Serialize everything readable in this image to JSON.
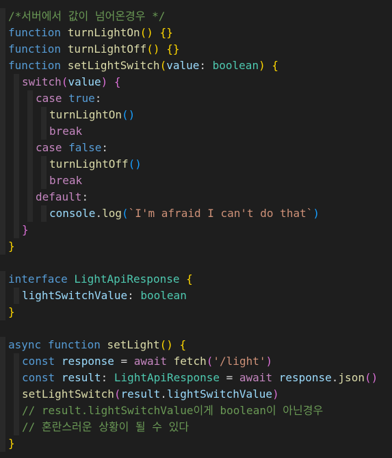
{
  "colors": {
    "background": "#1e1e1e",
    "comment": "#6a9955",
    "keyword": "#569cd6",
    "control": "#c586c0",
    "function": "#dcdcaa",
    "variable": "#9cdcfe",
    "type": "#4ec9b0",
    "string": "#ce9178",
    "plain": "#d4d4d4",
    "bracket_gold": "#ffd700",
    "bracket_pink": "#da70d6",
    "bracket_blue": "#179fff"
  },
  "code": {
    "lines": [
      {
        "indent": 0,
        "tokens": [
          {
            "t": "/*서버에서 값이 넘어온경우 */",
            "c": "comment"
          }
        ]
      },
      {
        "indent": 0,
        "tokens": [
          {
            "t": "function",
            "c": "keyword"
          },
          {
            "t": " ",
            "c": "plain"
          },
          {
            "t": "turnLightOn",
            "c": "function"
          },
          {
            "t": "()",
            "c": "bracket_gold"
          },
          {
            "t": " ",
            "c": "plain"
          },
          {
            "t": "{}",
            "c": "bracket_gold"
          }
        ]
      },
      {
        "indent": 0,
        "tokens": [
          {
            "t": "function",
            "c": "keyword"
          },
          {
            "t": " ",
            "c": "plain"
          },
          {
            "t": "turnLightOff",
            "c": "function"
          },
          {
            "t": "()",
            "c": "bracket_gold"
          },
          {
            "t": " ",
            "c": "plain"
          },
          {
            "t": "{}",
            "c": "bracket_gold"
          }
        ]
      },
      {
        "indent": 0,
        "tokens": [
          {
            "t": "function",
            "c": "keyword"
          },
          {
            "t": " ",
            "c": "plain"
          },
          {
            "t": "setLightSwitch",
            "c": "function"
          },
          {
            "t": "(",
            "c": "bracket_gold"
          },
          {
            "t": "value",
            "c": "variable"
          },
          {
            "t": ": ",
            "c": "plain"
          },
          {
            "t": "boolean",
            "c": "type"
          },
          {
            "t": ")",
            "c": "bracket_gold"
          },
          {
            "t": " ",
            "c": "plain"
          },
          {
            "t": "{",
            "c": "bracket_gold"
          }
        ]
      },
      {
        "indent": 1,
        "tokens": [
          {
            "t": "switch",
            "c": "control"
          },
          {
            "t": "(",
            "c": "bracket_pink"
          },
          {
            "t": "value",
            "c": "variable"
          },
          {
            "t": ")",
            "c": "bracket_pink"
          },
          {
            "t": " ",
            "c": "plain"
          },
          {
            "t": "{",
            "c": "bracket_pink"
          }
        ]
      },
      {
        "indent": 2,
        "tokens": [
          {
            "t": "case",
            "c": "control"
          },
          {
            "t": " ",
            "c": "plain"
          },
          {
            "t": "true",
            "c": "keyword"
          },
          {
            "t": ":",
            "c": "plain"
          }
        ]
      },
      {
        "indent": 3,
        "tokens": [
          {
            "t": "turnLightOn",
            "c": "function"
          },
          {
            "t": "()",
            "c": "bracket_blue"
          }
        ]
      },
      {
        "indent": 3,
        "tokens": [
          {
            "t": "break",
            "c": "control"
          }
        ]
      },
      {
        "indent": 2,
        "tokens": [
          {
            "t": "case",
            "c": "control"
          },
          {
            "t": " ",
            "c": "plain"
          },
          {
            "t": "false",
            "c": "keyword"
          },
          {
            "t": ":",
            "c": "plain"
          }
        ]
      },
      {
        "indent": 3,
        "tokens": [
          {
            "t": "turnLightOff",
            "c": "function"
          },
          {
            "t": "()",
            "c": "bracket_blue"
          }
        ]
      },
      {
        "indent": 3,
        "tokens": [
          {
            "t": "break",
            "c": "control"
          }
        ]
      },
      {
        "indent": 2,
        "tokens": [
          {
            "t": "default",
            "c": "control"
          },
          {
            "t": ":",
            "c": "plain"
          }
        ]
      },
      {
        "indent": 3,
        "tokens": [
          {
            "t": "console",
            "c": "variable"
          },
          {
            "t": ".",
            "c": "plain"
          },
          {
            "t": "log",
            "c": "function"
          },
          {
            "t": "(",
            "c": "bracket_blue"
          },
          {
            "t": "`I'm afraid I can't do that`",
            "c": "string"
          },
          {
            "t": ")",
            "c": "bracket_blue"
          }
        ]
      },
      {
        "indent": 1,
        "tokens": [
          {
            "t": "}",
            "c": "bracket_pink"
          }
        ]
      },
      {
        "indent": 0,
        "tokens": [
          {
            "t": "}",
            "c": "bracket_gold"
          }
        ]
      },
      {
        "indent": 0,
        "tokens": []
      },
      {
        "indent": 0,
        "tokens": [
          {
            "t": "interface",
            "c": "keyword"
          },
          {
            "t": " ",
            "c": "plain"
          },
          {
            "t": "LightApiResponse",
            "c": "type"
          },
          {
            "t": " ",
            "c": "plain"
          },
          {
            "t": "{",
            "c": "bracket_gold"
          }
        ]
      },
      {
        "indent": 1,
        "tokens": [
          {
            "t": "lightSwitchValue",
            "c": "variable"
          },
          {
            "t": ": ",
            "c": "plain"
          },
          {
            "t": "boolean",
            "c": "type"
          }
        ]
      },
      {
        "indent": 0,
        "tokens": [
          {
            "t": "}",
            "c": "bracket_gold"
          }
        ]
      },
      {
        "indent": 0,
        "tokens": []
      },
      {
        "indent": 0,
        "tokens": [
          {
            "t": "async",
            "c": "keyword"
          },
          {
            "t": " ",
            "c": "plain"
          },
          {
            "t": "function",
            "c": "keyword"
          },
          {
            "t": " ",
            "c": "plain"
          },
          {
            "t": "setLight",
            "c": "function"
          },
          {
            "t": "()",
            "c": "bracket_gold"
          },
          {
            "t": " ",
            "c": "plain"
          },
          {
            "t": "{",
            "c": "bracket_gold"
          }
        ]
      },
      {
        "indent": 1,
        "tokens": [
          {
            "t": "const",
            "c": "keyword"
          },
          {
            "t": " ",
            "c": "plain"
          },
          {
            "t": "response",
            "c": "variable"
          },
          {
            "t": " = ",
            "c": "plain"
          },
          {
            "t": "await",
            "c": "control"
          },
          {
            "t": " ",
            "c": "plain"
          },
          {
            "t": "fetch",
            "c": "function"
          },
          {
            "t": "(",
            "c": "bracket_pink"
          },
          {
            "t": "'/light'",
            "c": "string"
          },
          {
            "t": ")",
            "c": "bracket_pink"
          }
        ]
      },
      {
        "indent": 1,
        "tokens": [
          {
            "t": "const",
            "c": "keyword"
          },
          {
            "t": " ",
            "c": "plain"
          },
          {
            "t": "result",
            "c": "variable"
          },
          {
            "t": ": ",
            "c": "plain"
          },
          {
            "t": "LightApiResponse",
            "c": "type"
          },
          {
            "t": " = ",
            "c": "plain"
          },
          {
            "t": "await",
            "c": "control"
          },
          {
            "t": " ",
            "c": "plain"
          },
          {
            "t": "response",
            "c": "variable"
          },
          {
            "t": ".",
            "c": "plain"
          },
          {
            "t": "json",
            "c": "function"
          },
          {
            "t": "()",
            "c": "bracket_pink"
          }
        ]
      },
      {
        "indent": 1,
        "tokens": [
          {
            "t": "setLightSwitch",
            "c": "function"
          },
          {
            "t": "(",
            "c": "bracket_pink"
          },
          {
            "t": "result",
            "c": "variable"
          },
          {
            "t": ".",
            "c": "plain"
          },
          {
            "t": "lightSwitchValue",
            "c": "variable"
          },
          {
            "t": ")",
            "c": "bracket_pink"
          }
        ]
      },
      {
        "indent": 1,
        "tokens": [
          {
            "t": "// result.lightSwitchValue이게 boolean이 아닌경우",
            "c": "comment"
          }
        ]
      },
      {
        "indent": 1,
        "tokens": [
          {
            "t": "// 혼란스러운 상황이 될 수 있다",
            "c": "comment"
          }
        ]
      },
      {
        "indent": 0,
        "tokens": [
          {
            "t": "}",
            "c": "bracket_gold"
          }
        ]
      }
    ]
  }
}
